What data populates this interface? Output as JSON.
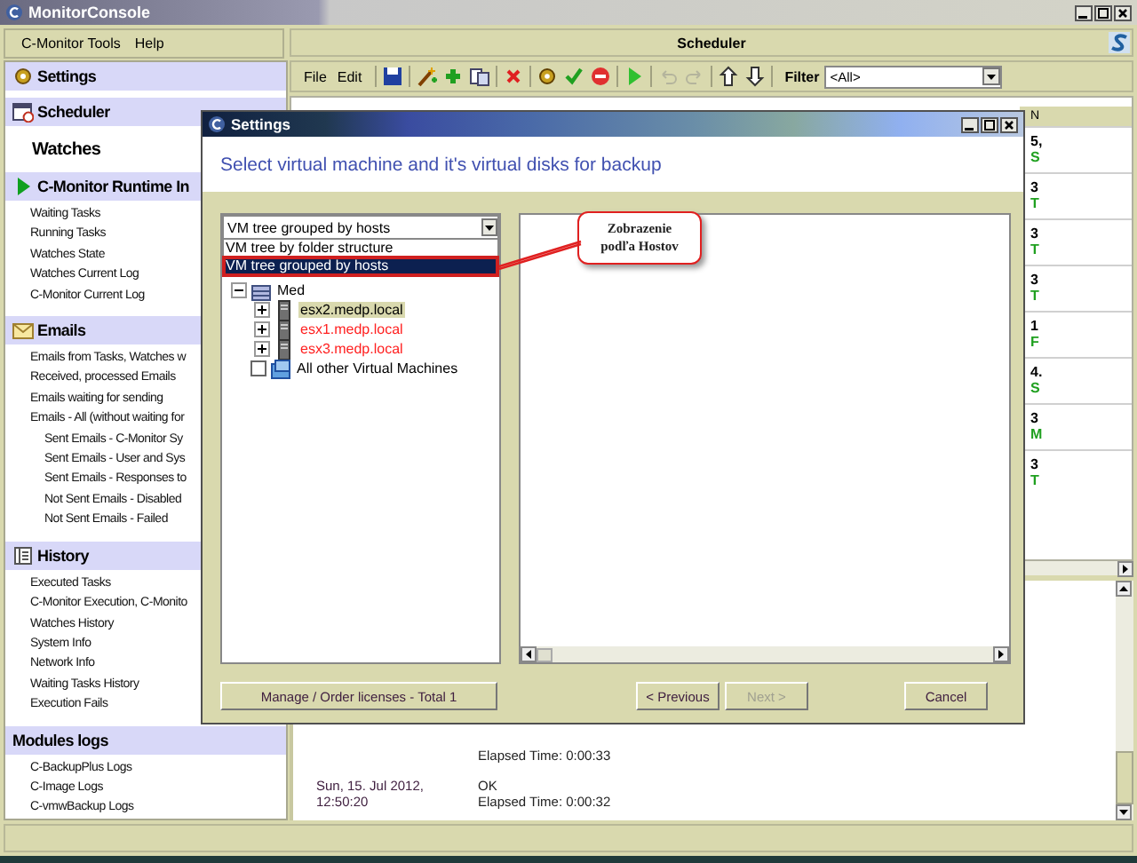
{
  "app_window": {
    "title": "MonitorConsole"
  },
  "menu": [
    "C-Monitor Tools",
    "Help"
  ],
  "sidebar": {
    "sections": [
      {
        "title": "Settings",
        "kind": "band"
      },
      {
        "title": "Scheduler",
        "kind": "band"
      },
      {
        "title": "Watches",
        "kind": "plain"
      },
      {
        "title": "C-Monitor Runtime In",
        "kind": "band",
        "items": [
          {
            "label": "Waiting Tasks"
          },
          {
            "label": "Running Tasks"
          },
          {
            "label": "Watches State"
          },
          {
            "label": "Watches Current Log"
          },
          {
            "label": "C-Monitor Current Log"
          }
        ]
      },
      {
        "title": "Emails",
        "kind": "band",
        "items": [
          {
            "label": "Emails from Tasks, Watches w"
          },
          {
            "label": "Received, processed Emails"
          },
          {
            "label": "Emails waiting for sending"
          },
          {
            "label": "Emails - All (without waiting for",
            "children": [
              {
                "label": "Sent Emails - C-Monitor Sy"
              },
              {
                "label": "Sent Emails - User and Sys"
              },
              {
                "label": "Sent Emails - Responses to"
              },
              {
                "label": "Not Sent Emails - Disabled"
              },
              {
                "label": "Not Sent Emails - Failed"
              }
            ]
          }
        ]
      },
      {
        "title": "History",
        "kind": "band",
        "items": [
          {
            "label": "Executed Tasks"
          },
          {
            "label": "C-Monitor Execution, C-Monito"
          },
          {
            "label": "Watches History"
          },
          {
            "label": "System Info"
          },
          {
            "label": "Network Info"
          },
          {
            "label": "Waiting Tasks History"
          },
          {
            "label": "Execution Fails"
          }
        ]
      },
      {
        "title": "Modules logs",
        "kind": "band",
        "items": [
          {
            "label": "C-BackupPlus Logs"
          },
          {
            "label": "C-Image Logs"
          },
          {
            "label": "C-vmwBackup Logs"
          }
        ]
      }
    ]
  },
  "scheduler": {
    "title": "Scheduler",
    "menus": [
      "File",
      "Edit"
    ],
    "tools": [
      {
        "kind": "separator"
      },
      {
        "kind": "save",
        "disabled": false
      },
      {
        "kind": "separator"
      },
      {
        "kind": "wand",
        "disabled": false
      },
      {
        "kind": "add",
        "disabled": false
      },
      {
        "kind": "copy",
        "disabled": false
      },
      {
        "kind": "separator"
      },
      {
        "kind": "delete",
        "disabled": false
      },
      {
        "kind": "separator"
      },
      {
        "kind": "gear",
        "disabled": false
      },
      {
        "kind": "check",
        "disabled": false
      },
      {
        "kind": "stop",
        "disabled": false
      },
      {
        "kind": "separator"
      },
      {
        "kind": "play",
        "disabled": false
      },
      {
        "kind": "separator"
      },
      {
        "kind": "undo",
        "disabled": true
      },
      {
        "kind": "redo",
        "disabled": true
      },
      {
        "kind": "separator"
      },
      {
        "kind": "up",
        "disabled": false
      },
      {
        "kind": "down",
        "disabled": false
      },
      {
        "kind": "separator"
      }
    ],
    "filter_label": "Filter",
    "filter_value": "<All>",
    "column_header": "N",
    "column_rows": [
      {
        "line_1": "5,",
        "line_2": "S"
      },
      {
        "line_1": "3",
        "line_2": "T"
      },
      {
        "line_1": "3",
        "line_2": "T"
      },
      {
        "line_1": "3",
        "line_2": "T"
      },
      {
        "line_1": "1",
        "line_2": "F"
      },
      {
        "line_1": "4.",
        "line_2": "S"
      },
      {
        "line_1": "3",
        "line_2": "M"
      },
      {
        "line_1": "3",
        "line_2": "T"
      }
    ],
    "log": [
      {
        "detail": "Elapsed Time: 0:00:33"
      },
      {
        "date": "Sun, 15. Jul 2012, 12:50:20",
        "result": "OK",
        "detail": "Elapsed Time: 0:00:32"
      }
    ]
  },
  "dialog": {
    "title": "Settings",
    "heading": "Select virtual machine and it's virtual disks for backup",
    "view_select": {
      "value": "VM tree grouped by hosts",
      "options": [
        {
          "label": "VM tree by folder structure",
          "selected": false
        },
        {
          "label": "VM tree grouped by hosts",
          "selected": true
        }
      ]
    },
    "tree": [
      {
        "label": "Med",
        "kind": "datacenter",
        "expanded": true,
        "children": [
          {
            "label": "esx2.medp.local",
            "kind": "host",
            "expanded": false,
            "selected": true,
            "color": "#000000"
          },
          {
            "label": "esx1.medp.local",
            "kind": "host",
            "expanded": false,
            "selected": false,
            "color": "#ff2020"
          },
          {
            "label": "esx3.medp.local",
            "kind": "host",
            "expanded": false,
            "selected": false,
            "color": "#ff2020"
          }
        ]
      },
      {
        "label": "All other Virtual Machines",
        "kind": "folder",
        "checked": false
      }
    ],
    "callout": "Zobrazenie podľa Hostov",
    "buttons": [
      {
        "label": "Manage / Order licenses - Total 1",
        "kind": "license",
        "disabled": false
      },
      {
        "label": "< Previous",
        "kind": "nav",
        "disabled": false
      },
      {
        "label": "Next >",
        "kind": "nav",
        "disabled": true
      },
      {
        "label": "Cancel",
        "kind": "cancel",
        "disabled": false
      }
    ]
  }
}
